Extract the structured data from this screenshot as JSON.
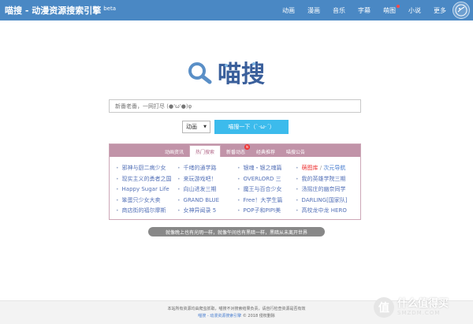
{
  "header": {
    "title": "喵搜 - 动漫资源搜索引擎",
    "badge": "beta",
    "nav": [
      {
        "label": "动画"
      },
      {
        "label": "漫画"
      },
      {
        "label": "音乐"
      },
      {
        "label": "字幕"
      },
      {
        "label": "萌图",
        "dot": true
      },
      {
        "label": "小说"
      },
      {
        "label": "更多"
      }
    ]
  },
  "logo": {
    "text": "喵搜"
  },
  "search": {
    "placeholder": "新番老番，一网打尽 (●'ω'●)φ",
    "type_value": "动画",
    "button_label": "喵搜一下（`·ω·´）"
  },
  "panel": {
    "tabs": [
      {
        "label": "动画资讯"
      },
      {
        "label": "热门搜索",
        "active": true
      },
      {
        "label": "新番动态",
        "badge": "N"
      },
      {
        "label": "经典推荐"
      },
      {
        "label": "喵搜公告"
      }
    ],
    "columns": [
      [
        "邪神与厨二病少女",
        "现实主义的勇者之国",
        "Happy Sugar Life",
        "笨蛋只少女大卖",
        "商店街的福尔摩斯"
      ],
      [
        "千绪的通学路",
        "来玩游戏吧！",
        "向山进发三期",
        "GRAND BLUE",
        "女神异闻录 5"
      ],
      [
        "银魂・银之魂篇",
        "OVERLORD 三",
        "魔王与百合少女",
        "Free！大学生篇",
        "POP子和PIPI美"
      ],
      [
        "萌图库",
        "我的英雄学院三期",
        "汤摇庄的幽奈同学",
        "DARLING[国家队]",
        "高校龙中龙 HERO"
      ]
    ],
    "special": {
      "first": "萌图库",
      "sep": "/",
      "second": "次元导航"
    }
  },
  "slogan": "就像晚上也有光明一样，就像午间也有黑暗一样，黑暗从未离开世界",
  "footer": {
    "line1": "本站所有资源均由爬虫抓取，喵搜不对搜索结果负责，请自行检查资源是否有效",
    "link1": "喵搜 - 动漫资源搜索引擎",
    "copyright": "© 2018 侵权删除"
  },
  "watermark": {
    "cn": "什么值得买",
    "en": "SMZDM.COM",
    "mark": "值"
  },
  "colors": {
    "topbar": "#4a88c4",
    "button": "#3cbbec",
    "panel_tab": "#c193a8",
    "link": "#5572b8"
  }
}
